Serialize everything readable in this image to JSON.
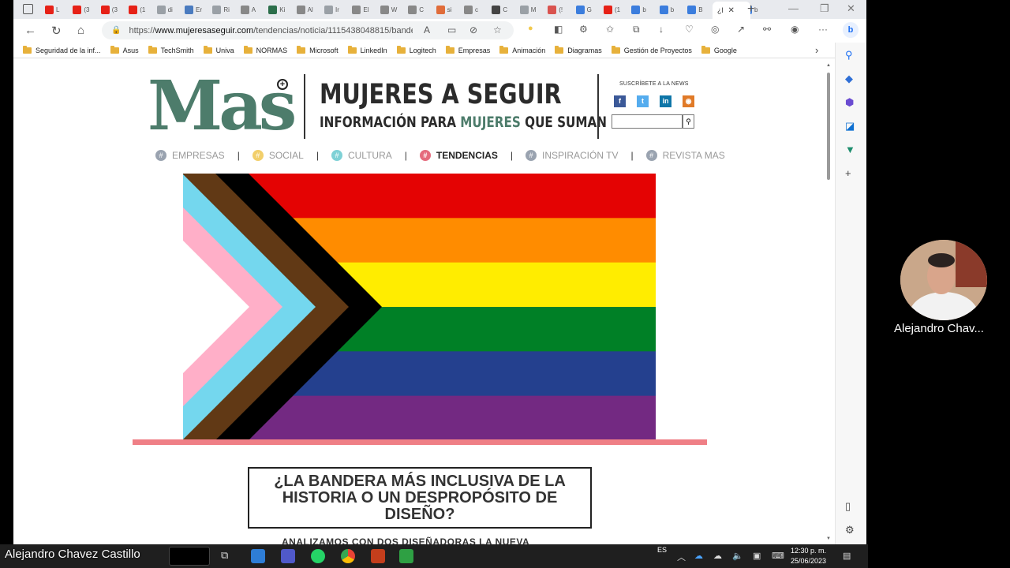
{
  "browser": {
    "tabs": [
      {
        "label": "L",
        "color": "#e62117"
      },
      {
        "label": "(3",
        "color": "#e62117"
      },
      {
        "label": "(3",
        "color": "#e62117"
      },
      {
        "label": "(1",
        "color": "#e62117"
      },
      {
        "label": "di",
        "color": "#9aa0a6"
      },
      {
        "label": "Er",
        "color": "#4a7bbf"
      },
      {
        "label": "Ri",
        "color": "#9aa0a6"
      },
      {
        "label": "A",
        "color": "#888"
      },
      {
        "label": "Ki",
        "color": "#2b6e4a"
      },
      {
        "label": "Al",
        "color": "#888"
      },
      {
        "label": "Ir",
        "color": "#9aa0a6"
      },
      {
        "label": "El",
        "color": "#888"
      },
      {
        "label": "W",
        "color": "#888"
      },
      {
        "label": "C",
        "color": "#888"
      },
      {
        "label": "si",
        "color": "#e06c3a"
      },
      {
        "label": "c",
        "color": "#888"
      },
      {
        "label": "C",
        "color": "#444"
      },
      {
        "label": "M",
        "color": "#9aa0a6"
      },
      {
        "label": "(!",
        "color": "#d9534f"
      },
      {
        "label": "G",
        "color": "#3b7ddd"
      },
      {
        "label": "(1",
        "color": "#e62117"
      },
      {
        "label": "b",
        "color": "#3b7ddd"
      },
      {
        "label": "b",
        "color": "#3b7ddd"
      },
      {
        "label": "B",
        "color": "#3b7ddd"
      },
      {
        "label": "b",
        "color": "#3b7ddd"
      },
      {
        "label": "b",
        "color": "#3b7ddd"
      }
    ],
    "active_tab": "¿l",
    "url_prefix": "https://",
    "url_domain": "www.mujeresaseguir.com",
    "url_path": "/tendencias/noticia/1115438048815/bander...",
    "bookmarks": [
      "Seguridad de la inf...",
      "Asus",
      "TechSmith",
      "Univa",
      "NORMAS",
      "Microsoft",
      "LinkedIn",
      "Logitech",
      "Empresas",
      "Animación",
      "Diagramas",
      "Gestión de Proyectos",
      "Google"
    ]
  },
  "site": {
    "logo": "Mas",
    "logo_plus": "+",
    "title": "MUJERES A SEGUIR",
    "subtitle_pre": "INFORMACIÓN PARA ",
    "subtitle_green": "MUJERES",
    "subtitle_post": " QUE SUMAN",
    "newsletter_label": "SUSCRÍBETE A LA NEWS",
    "social": [
      {
        "icon": "facebook-icon",
        "glyph": "f",
        "color": "#3b5998"
      },
      {
        "icon": "twitter-icon",
        "glyph": "t",
        "color": "#55acee"
      },
      {
        "icon": "linkedin-icon",
        "glyph": "in",
        "color": "#0e76a8"
      },
      {
        "icon": "rss-icon",
        "glyph": "◉",
        "color": "#e07a28"
      }
    ],
    "nav": [
      {
        "label": "EMPRESAS",
        "color": "#9aa3b0"
      },
      {
        "label": "SOCIAL",
        "color": "#f2cf6b"
      },
      {
        "label": "CULTURA",
        "color": "#7fd1d6"
      },
      {
        "label": "TENDENCIAS",
        "color": "#e56b7d",
        "active": true
      },
      {
        "label": "INSPIRACIÓN TV",
        "color": "#9aa3b0"
      },
      {
        "label": "REVISTA MAS",
        "color": "#9aa3b0"
      }
    ]
  },
  "article": {
    "headline": "¿LA BANDERA MÁS INCLUSIVA DE LA HISTORIA O UN DESPROPÓSITO DE DISEÑO?",
    "subheadline": "ANALIZAMOS CON DOS DISEÑADORAS LA NUEVA"
  },
  "flag_colors": {
    "stripes": [
      "#e40303",
      "#ff8c00",
      "#ffed00",
      "#008026",
      "#24408e",
      "#732982"
    ],
    "chevrons": [
      "#000000",
      "#613915",
      "#74d7ee",
      "#ffafc8",
      "#ffffff"
    ]
  },
  "call": {
    "participant_name": "Alejandro Chav...",
    "caller_label": "Alejandro Chavez Castillo"
  },
  "taskbar": {
    "language": "ES",
    "time": "12:30 p. m.",
    "date": "25/06/2023"
  }
}
